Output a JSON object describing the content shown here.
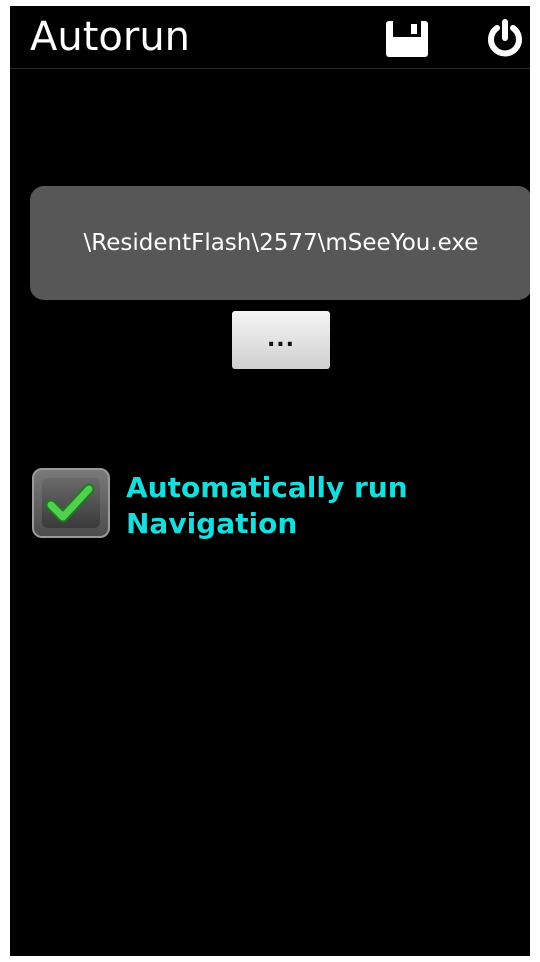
{
  "header": {
    "title": "Autorun",
    "save_icon": "floppy-disk-icon",
    "power_icon": "power-icon"
  },
  "path": {
    "value": "\\ResidentFlash\\2577\\mSeeYou.exe"
  },
  "browse": {
    "label": "..."
  },
  "autorun_option": {
    "checked": true,
    "label_line1": "Automatically run",
    "label_line2": "Navigation",
    "check_icon": "checkmark-icon"
  },
  "colors": {
    "background": "#000000",
    "path_box": "#575757",
    "label_accent": "#19dcdc",
    "check_green": "#3fc23f"
  }
}
